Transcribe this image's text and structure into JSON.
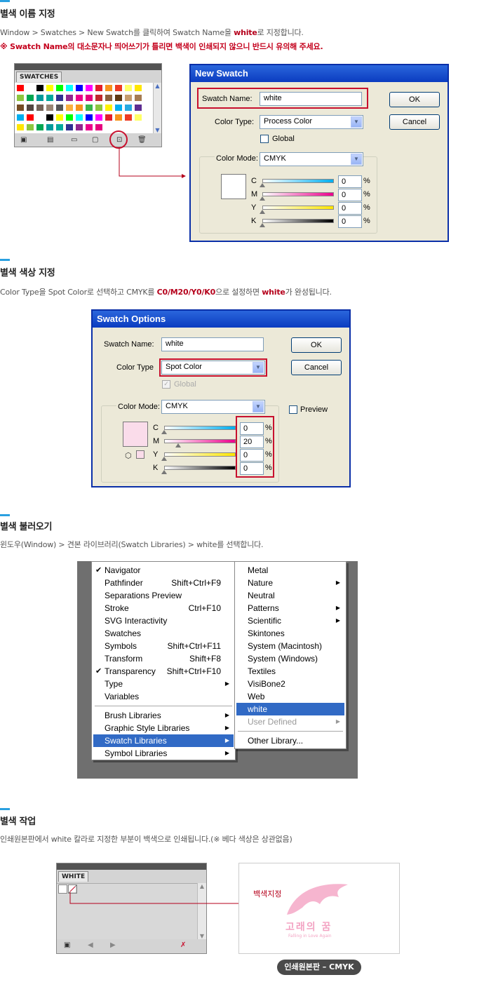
{
  "sections": [
    {
      "title": "별색 이름 지정",
      "desc_parts": [
        "Window > Swatches > New Swatch를 클릭하여 Swatch Name을 ",
        "white",
        "로 지정합니다."
      ],
      "warning": "※ Swatch Name의 대소문자나 띄어쓰기가 틀리면 백색이 인쇄되지 않으니 반드시 유의해 주세요."
    },
    {
      "title": "별색 색상 지정",
      "desc_parts": [
        "Color Type을 Spot Color로 선택하고 CMYK를 ",
        "C0/M20/Y0/K0",
        "으로 설정하면 ",
        "white",
        "가 완성됩니다."
      ]
    },
    {
      "title": "별색 불러오기",
      "desc": "윈도우(Window) > 견본 라이브러리(Swatch Libraries) > white를 선택합니다."
    },
    {
      "title": "별색 작업",
      "desc": "인쇄원본판에서 white 칼라로 지정한 부분이 백색으로 인쇄됩니다.(※ 베다 색상은 상관없음)"
    }
  ],
  "swatches_panel": {
    "tab": "SWATCHES"
  },
  "new_swatch": {
    "title": "New Swatch",
    "name_label": "Swatch Name:",
    "name_value": "white",
    "type_label": "Color Type:",
    "type_value": "Process Color",
    "global_label": "Global",
    "mode_label": "Color Mode:",
    "mode_value": "CMYK",
    "ok": "OK",
    "cancel": "Cancel",
    "channels": [
      {
        "k": "C",
        "v": "0"
      },
      {
        "k": "M",
        "v": "0"
      },
      {
        "k": "Y",
        "v": "0"
      },
      {
        "k": "K",
        "v": "0"
      }
    ],
    "pct": "%"
  },
  "swatch_options": {
    "title": "Swatch Options",
    "name_label": "Swatch Name:",
    "name_value": "white",
    "type_label": "Color Type",
    "type_value": "Spot Color",
    "global_label": "Global",
    "mode_label": "Color Mode:",
    "mode_value": "CMYK",
    "preview_label": "Preview",
    "ok": "OK",
    "cancel": "Cancel",
    "channels": [
      {
        "k": "C",
        "v": "0"
      },
      {
        "k": "M",
        "v": "20"
      },
      {
        "k": "Y",
        "v": "0"
      },
      {
        "k": "K",
        "v": "0"
      }
    ],
    "pct": "%"
  },
  "window_menu": {
    "items": [
      {
        "label": "Navigator",
        "shortcut": "",
        "check": true
      },
      {
        "label": "Pathfinder",
        "shortcut": "Shift+Ctrl+F9"
      },
      {
        "label": "Separations Preview",
        "shortcut": ""
      },
      {
        "label": "Stroke",
        "shortcut": "Ctrl+F10"
      },
      {
        "label": "SVG Interactivity",
        "shortcut": ""
      },
      {
        "label": "Swatches",
        "shortcut": ""
      },
      {
        "label": "Symbols",
        "shortcut": "Shift+Ctrl+F11"
      },
      {
        "label": "Transform",
        "shortcut": "Shift+F8"
      },
      {
        "label": "Transparency",
        "shortcut": "Shift+Ctrl+F10",
        "check": true
      },
      {
        "label": "Type",
        "shortcut": "",
        "arrow": true
      },
      {
        "label": "Variables",
        "shortcut": ""
      }
    ],
    "lib_items": [
      {
        "label": "Brush Libraries",
        "arrow": true
      },
      {
        "label": "Graphic Style Libraries",
        "arrow": true
      },
      {
        "label": "Swatch Libraries",
        "arrow": true,
        "hl": true
      },
      {
        "label": "Symbol Libraries",
        "arrow": true
      }
    ]
  },
  "library_menu": {
    "items": [
      {
        "label": "Metal"
      },
      {
        "label": "Nature",
        "arrow": true
      },
      {
        "label": "Neutral"
      },
      {
        "label": "Patterns",
        "arrow": true
      },
      {
        "label": "Scientific",
        "arrow": true
      },
      {
        "label": "Skintones"
      },
      {
        "label": "System (Macintosh)"
      },
      {
        "label": "System (Windows)"
      },
      {
        "label": "Textiles"
      },
      {
        "label": "VisiBone2"
      },
      {
        "label": "Web"
      },
      {
        "label": "white",
        "hl": true
      },
      {
        "label": "User Defined",
        "arrow": true,
        "dis": true
      }
    ],
    "other": "Other Library..."
  },
  "white_panel": {
    "tab": "WHITE"
  },
  "print_area": {
    "annotation": "백색지정",
    "logo_text": "고래의 꿈",
    "logo_sub": "Falling in Love Again",
    "badge": "인쇄원본판 – CMYK"
  },
  "colors": {
    "accent_red": "#b5001b",
    "section_bar": "#2aa0e0",
    "highlight": "#316ac5"
  }
}
